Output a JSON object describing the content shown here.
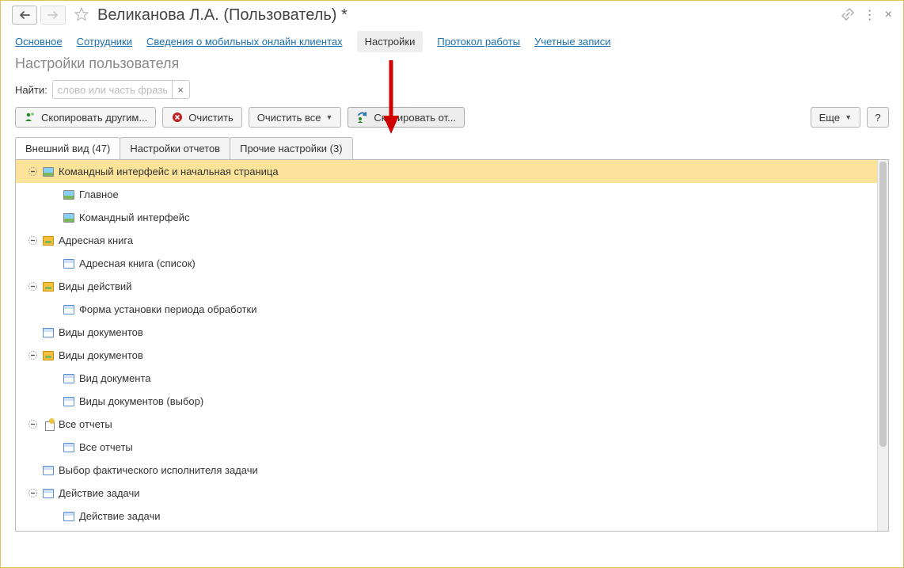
{
  "header": {
    "title": "Великанова Л.А. (Пользователь) *"
  },
  "nav_tabs": {
    "main": "Основное",
    "employees": "Сотрудники",
    "mobile_clients": "Сведения о мобильных онлайн клиентах",
    "settings": "Настройки",
    "protocol": "Протокол работы",
    "accounts": "Учетные записи"
  },
  "subtitle": "Настройки пользователя",
  "search": {
    "label": "Найти:",
    "placeholder": "слово или часть фразы"
  },
  "toolbar": {
    "copy_to": "Скопировать другим...",
    "clear": "Очистить",
    "clear_all": "Очистить все",
    "copy_from": "Скопировать от...",
    "more": "Еще",
    "help": "?"
  },
  "tabs": {
    "appearance": "Внешний вид (47)",
    "reports": "Настройки отчетов",
    "other": "Прочие настройки (3)"
  },
  "tree": [
    {
      "level": 0,
      "expander": "minus",
      "icon": "pic",
      "label": "Командный интерфейс и начальная страница",
      "selected": true
    },
    {
      "level": 1,
      "expander": "none",
      "icon": "pic",
      "label": "Главное"
    },
    {
      "level": 1,
      "expander": "none",
      "icon": "pic",
      "label": "Командный интерфейс"
    },
    {
      "level": 0,
      "expander": "minus",
      "icon": "yel",
      "label": "Адресная книга"
    },
    {
      "level": 1,
      "expander": "none",
      "icon": "form",
      "label": "Адресная книга (список)"
    },
    {
      "level": 0,
      "expander": "minus",
      "icon": "yel",
      "label": "Виды действий"
    },
    {
      "level": 1,
      "expander": "none",
      "icon": "form",
      "label": "Форма установки периода обработки"
    },
    {
      "level": 0,
      "expander": "none-pad",
      "icon": "form",
      "label": "Виды документов"
    },
    {
      "level": 0,
      "expander": "minus",
      "icon": "yel",
      "label": "Виды документов"
    },
    {
      "level": 1,
      "expander": "none",
      "icon": "form",
      "label": "Вид документа"
    },
    {
      "level": 1,
      "expander": "none",
      "icon": "form",
      "label": "Виды документов (выбор)"
    },
    {
      "level": 0,
      "expander": "minus",
      "icon": "report",
      "label": "Все отчеты"
    },
    {
      "level": 1,
      "expander": "none",
      "icon": "form",
      "label": "Все отчеты"
    },
    {
      "level": 0,
      "expander": "none-pad",
      "icon": "form",
      "label": "Выбор фактического исполнителя задачи"
    },
    {
      "level": 0,
      "expander": "minus",
      "icon": "form",
      "label": "Действие задачи"
    },
    {
      "level": 1,
      "expander": "none",
      "icon": "form",
      "label": "Действие задачи"
    }
  ]
}
